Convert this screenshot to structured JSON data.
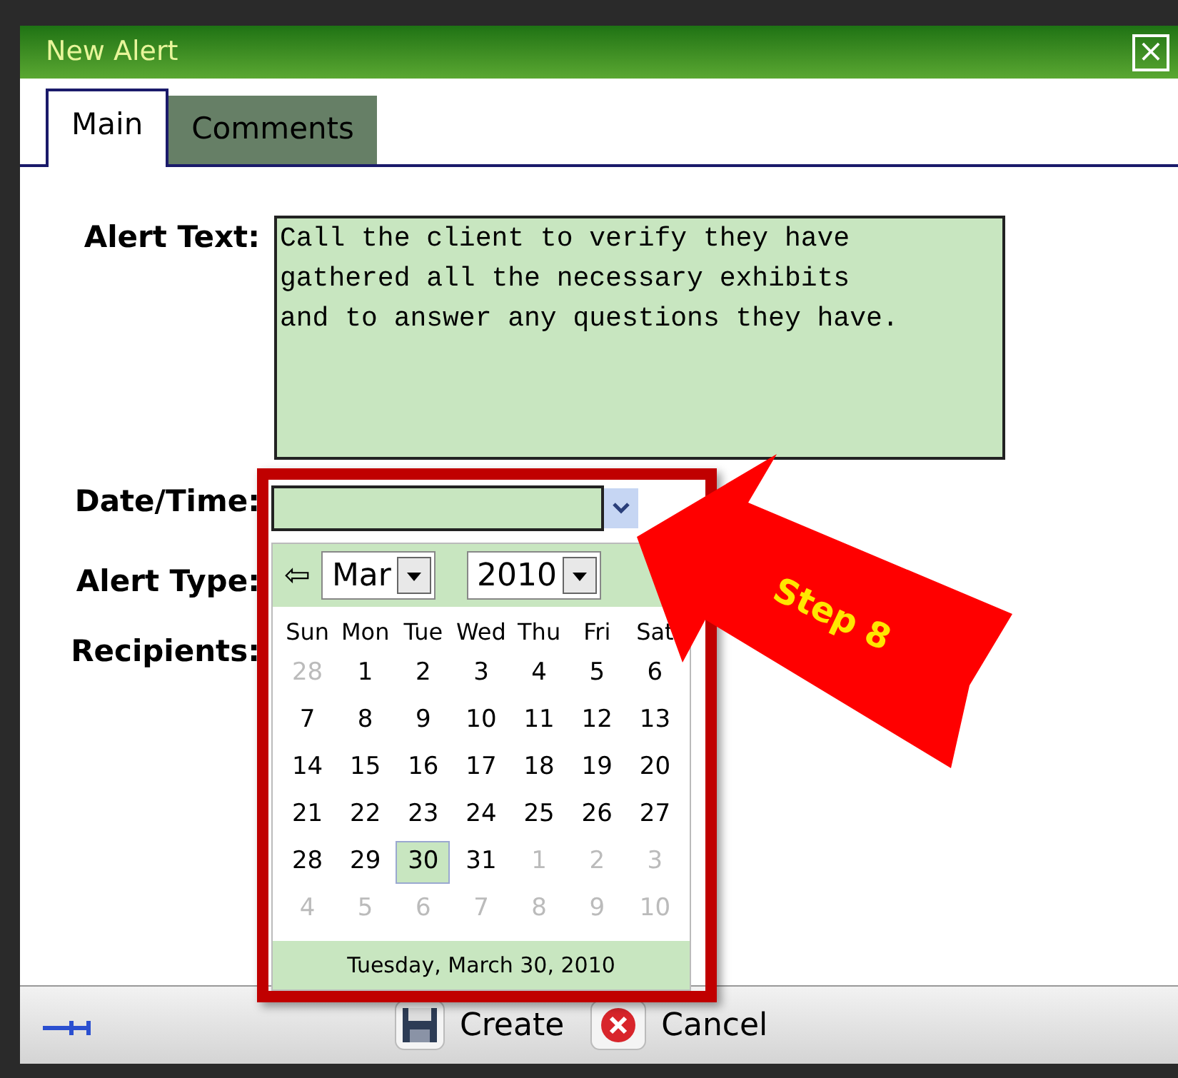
{
  "window": {
    "title": "New Alert",
    "close": "×"
  },
  "tabs": [
    {
      "label": "Main",
      "selected": true
    },
    {
      "label": "Comments",
      "selected": false
    }
  ],
  "form": {
    "alert_text_label": "Alert Text:",
    "alert_text": "Call the client to verify they have\ngathered all the necessary exhibits\nand to answer any questions they have.",
    "date_label": "Date/Time:",
    "alert_type_label": "Alert Type:",
    "recipients_label": "Recipients:"
  },
  "calendar": {
    "prev": "⇦",
    "month": "Mar",
    "year": "2010",
    "weekdays": [
      "Sun",
      "Mon",
      "Tue",
      "Wed",
      "Thu",
      "Fri",
      "Sat"
    ],
    "weeks": [
      [
        {
          "d": "28",
          "muted": true,
          "selected": false
        },
        {
          "d": "1",
          "muted": false,
          "selected": false
        },
        {
          "d": "2",
          "muted": false,
          "selected": false
        },
        {
          "d": "3",
          "muted": false,
          "selected": false
        },
        {
          "d": "4",
          "muted": false,
          "selected": false
        },
        {
          "d": "5",
          "muted": false,
          "selected": false
        },
        {
          "d": "6",
          "muted": false,
          "selected": false
        }
      ],
      [
        {
          "d": "7",
          "muted": false,
          "selected": false
        },
        {
          "d": "8",
          "muted": false,
          "selected": false
        },
        {
          "d": "9",
          "muted": false,
          "selected": false
        },
        {
          "d": "10",
          "muted": false,
          "selected": false
        },
        {
          "d": "11",
          "muted": false,
          "selected": false
        },
        {
          "d": "12",
          "muted": false,
          "selected": false
        },
        {
          "d": "13",
          "muted": false,
          "selected": false
        }
      ],
      [
        {
          "d": "14",
          "muted": false,
          "selected": false
        },
        {
          "d": "15",
          "muted": false,
          "selected": false
        },
        {
          "d": "16",
          "muted": false,
          "selected": false
        },
        {
          "d": "17",
          "muted": false,
          "selected": false
        },
        {
          "d": "18",
          "muted": false,
          "selected": false
        },
        {
          "d": "19",
          "muted": false,
          "selected": false
        },
        {
          "d": "20",
          "muted": false,
          "selected": false
        }
      ],
      [
        {
          "d": "21",
          "muted": false,
          "selected": false
        },
        {
          "d": "22",
          "muted": false,
          "selected": false
        },
        {
          "d": "23",
          "muted": false,
          "selected": false
        },
        {
          "d": "24",
          "muted": false,
          "selected": false
        },
        {
          "d": "25",
          "muted": false,
          "selected": false
        },
        {
          "d": "26",
          "muted": false,
          "selected": false
        },
        {
          "d": "27",
          "muted": false,
          "selected": false
        }
      ],
      [
        {
          "d": "28",
          "muted": false,
          "selected": false
        },
        {
          "d": "29",
          "muted": false,
          "selected": false
        },
        {
          "d": "30",
          "muted": false,
          "selected": true
        },
        {
          "d": "31",
          "muted": false,
          "selected": false
        },
        {
          "d": "1",
          "muted": true,
          "selected": false
        },
        {
          "d": "2",
          "muted": true,
          "selected": false
        },
        {
          "d": "3",
          "muted": true,
          "selected": false
        }
      ],
      [
        {
          "d": "4",
          "muted": true,
          "selected": false
        },
        {
          "d": "5",
          "muted": true,
          "selected": false
        },
        {
          "d": "6",
          "muted": true,
          "selected": false
        },
        {
          "d": "7",
          "muted": true,
          "selected": false
        },
        {
          "d": "8",
          "muted": true,
          "selected": false
        },
        {
          "d": "9",
          "muted": true,
          "selected": false
        },
        {
          "d": "10",
          "muted": true,
          "selected": false
        }
      ]
    ],
    "today": "Tuesday, March 30, 2010"
  },
  "callout": "Step 8",
  "footer": {
    "create": "Create",
    "cancel": "Cancel"
  }
}
